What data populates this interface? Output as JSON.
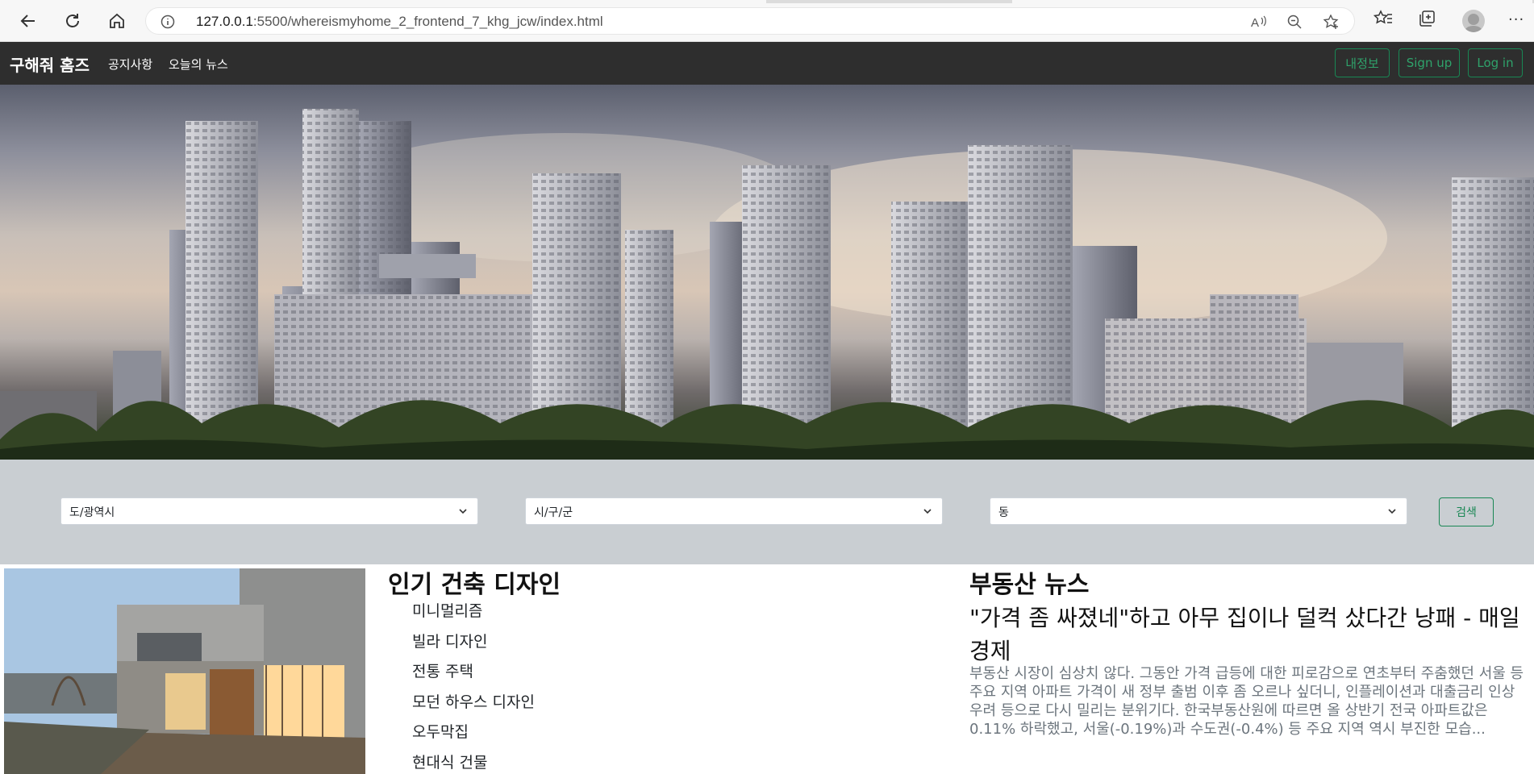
{
  "browser": {
    "url_host": "127.0.0.1",
    "url_rest": ":5500/whereismyhome_2_frontend_7_khg_jcw/index.html",
    "icons": [
      "back-icon",
      "refresh-icon",
      "home-icon",
      "info-icon",
      "read-aloud-icon",
      "zoom-out-icon",
      "add-favorite-icon",
      "favorites-icon",
      "collections-icon",
      "profile-icon",
      "more-icon"
    ],
    "more_glyph": "···"
  },
  "navbar": {
    "brand": "구해줘 홈즈",
    "links": [
      "공지사항",
      "오늘의 뉴스"
    ],
    "buttons": [
      "내정보",
      "Sign up",
      "Log in"
    ],
    "accent_color": "#198754"
  },
  "search": {
    "selects": [
      "도/광역시",
      "시/구/군",
      "동"
    ],
    "button": "검색"
  },
  "design": {
    "title": "인기 건축 디자인",
    "items": [
      "미니멀리즘",
      "빌라 디자인",
      "전통 주택",
      "모던 하우스 디자인",
      "오두막집",
      "현대식 건물"
    ]
  },
  "news": {
    "section_title": "부동산 뉴스",
    "headline": "\"가격 좀 싸졌네\"하고 아무 집이나 덜컥 샀다간 낭패 - 매일경제",
    "body": "부동산 시장이 심상치 않다. 그동안 가격 급등에 대한 피로감으로 연초부터 주춤했던 서울 등 주요 지역 아파트 가격이 새 정부 출범 이후 좀 오르나 싶더니, 인플레이션과 대출금리 인상 우려 등으로 다시 밀리는 분위기다. 한국부동산원에 따르면 올 상반기 전국 아파트값은 0.11% 하락했고, 서울(-0.19%)과 수도권(-0.4%) 등 주요 지역 역시 부진한 모습..."
  }
}
